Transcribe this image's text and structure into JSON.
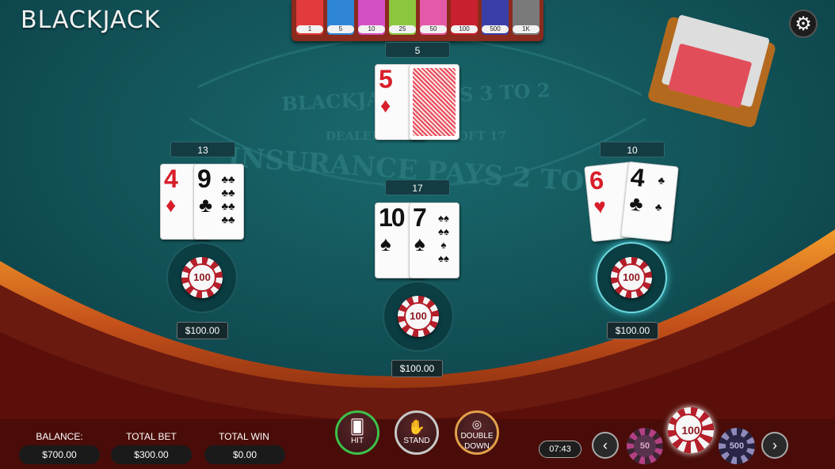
{
  "title": "BLACKJACK",
  "table_text": {
    "line1": "BLACKJACK PAYS 3 TO 2",
    "line2": "DEALER HITS ON SOFT 17",
    "line3": "INSURANCE PAYS 2 TO 1"
  },
  "rack_chips": [
    {
      "label": "1",
      "color": "#e33b3b"
    },
    {
      "label": "5",
      "color": "#2f86d6"
    },
    {
      "label": "10",
      "color": "#d44fc4"
    },
    {
      "label": "25",
      "color": "#8cc63f"
    },
    {
      "label": "50",
      "color": "#e45aa8"
    },
    {
      "label": "100",
      "color": "#c8202e"
    },
    {
      "label": "500",
      "color": "#3a3fa8"
    },
    {
      "label": "1K",
      "color": "#7a7a7a"
    }
  ],
  "dealer": {
    "score": "5",
    "up_rank": "5",
    "up_suit": "♦"
  },
  "hands": [
    {
      "score": "13",
      "cards": [
        {
          "rank": "4",
          "suit": "♦"
        },
        {
          "rank": "9",
          "suit": "♣"
        }
      ],
      "bet_chip": "100",
      "bet_amount": "$100.00"
    },
    {
      "score": "17",
      "cards": [
        {
          "rank": "10",
          "suit": "♠"
        },
        {
          "rank": "7",
          "suit": "♠"
        }
      ],
      "bet_chip": "100",
      "bet_amount": "$100.00"
    },
    {
      "score": "10",
      "cards": [
        {
          "rank": "6",
          "suit": "♥"
        },
        {
          "rank": "4",
          "suit": "♣"
        }
      ],
      "bet_chip": "100",
      "bet_amount": "$100.00"
    }
  ],
  "actions": {
    "hit": "HIT",
    "stand": "STAND",
    "double_1": "DOUBLE",
    "double_2": "DOWN"
  },
  "stats": {
    "balance_label": "BALANCE:",
    "balance": "$700.00",
    "total_bet_label": "TOTAL BET",
    "total_bet": "$300.00",
    "total_win_label": "TOTAL WIN",
    "total_win": "$0.00"
  },
  "clock": "07:43",
  "chip_selector": {
    "left": "50",
    "selected": "100",
    "right": "500"
  },
  "icons": {
    "settings": "gear-icon",
    "prev": "chevron-left-icon",
    "next": "chevron-right-icon"
  }
}
